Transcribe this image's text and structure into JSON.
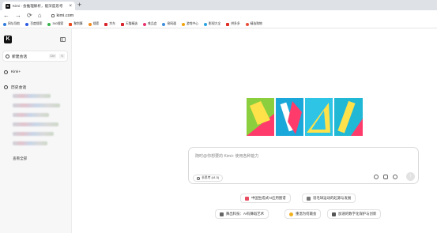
{
  "browser": {
    "tab_title": "Kimi - 会推理解析，能深度思考",
    "tab_close": "×",
    "new_tab": "+",
    "url": "kimi.com",
    "nav": {
      "back": "←",
      "forward": "→",
      "reload": "⟳",
      "home": "⌂"
    },
    "bookmarks": [
      "网址导航",
      "百度搜索",
      "360搜索",
      "聚划算",
      "搜索",
      "京东",
      "天猫精选",
      "唯品会",
      "易网通",
      "游戏中心",
      "影视大全",
      "拼多多",
      "精选购物"
    ]
  },
  "sidebar": {
    "logo": "K",
    "new_chat": {
      "label": "新建会话",
      "kbd1": "Ctrl",
      "kbd2": "K"
    },
    "kimi_plus": "Kimi+",
    "history_title": "历史会话",
    "view_all": "查看全部"
  },
  "composer": {
    "placeholder": "随时@你想要的 Kimi+ 使用各种能力",
    "chip_label": "长思考 (k1.5)",
    "send_icon": "↑"
  },
  "suggestions": [
    {
      "label": "中国生成式AI应用图谱",
      "color": "#e84a5f"
    },
    {
      "label": "羽毛球运动的起源与发展",
      "color": "#777777"
    },
    {
      "label": "舞出科技：AI有舞蹈艺术",
      "color": "#666666"
    },
    {
      "label": "重温为何最会",
      "color": "#f2b01e"
    },
    {
      "label": "加速的数字化保护与创新",
      "color": "#555555"
    }
  ],
  "hero_colors": [
    "#8ccf3e",
    "#1aa7d9",
    "#2ec4e6",
    "#21b8d6"
  ]
}
